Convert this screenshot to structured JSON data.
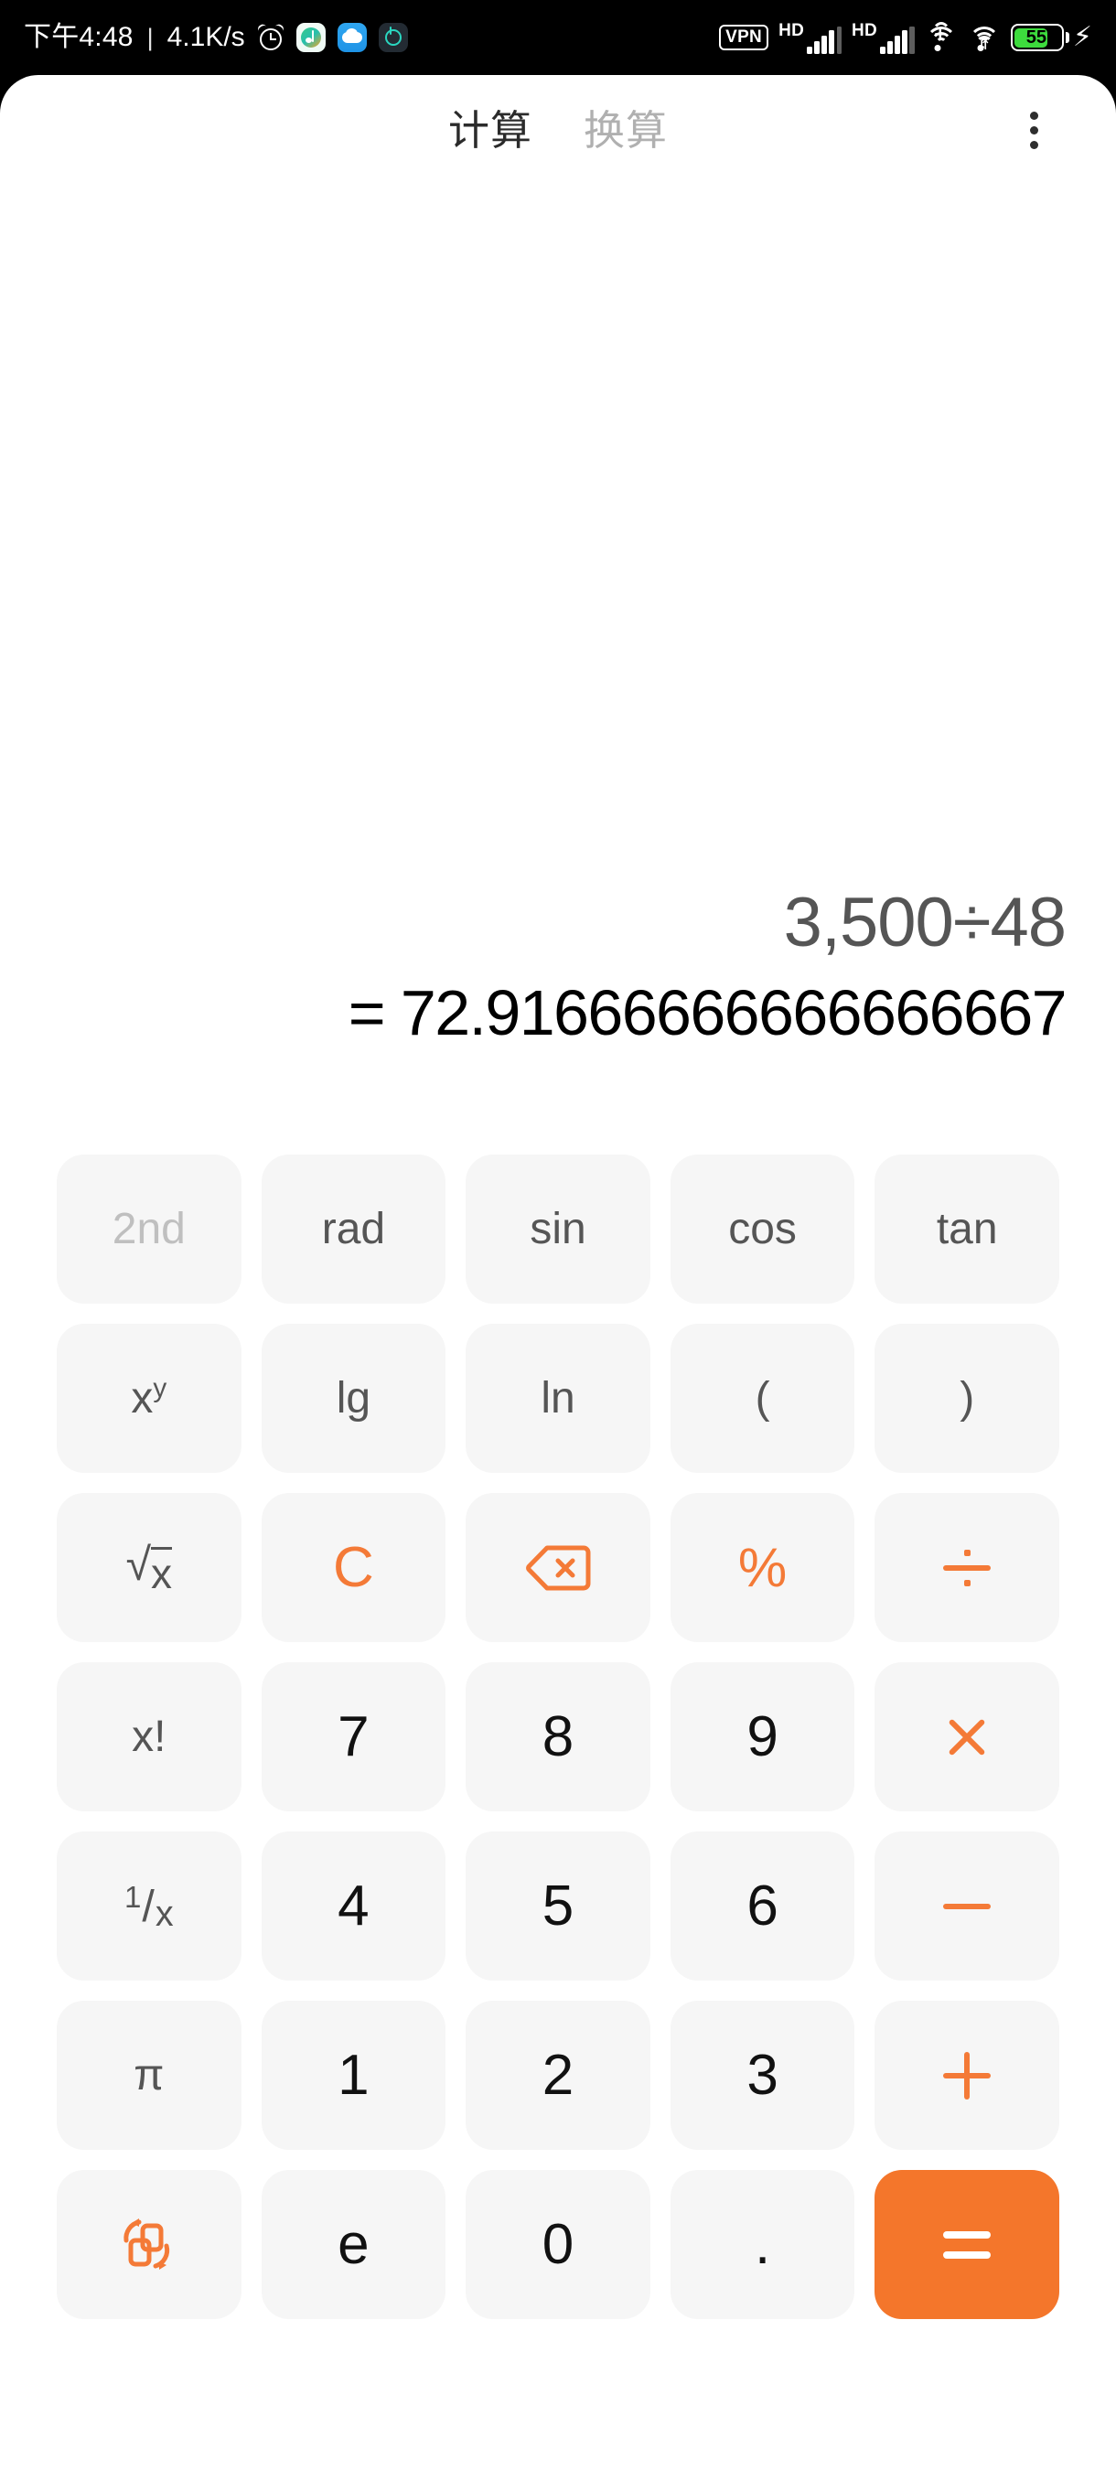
{
  "status_bar": {
    "clock": "下午4:48",
    "separator": "|",
    "network_speed": "4.1K/s",
    "left_icons": [
      "alarm-icon",
      "music-app-icon",
      "cloud-app-icon",
      "ring-app-icon"
    ],
    "vpn_label": "VPN",
    "sim1": {
      "hd_label": "HD",
      "bars": 4
    },
    "sim2": {
      "hd_label": "HD",
      "bars": 4
    },
    "wifi_primary": "wifi-plus-icon",
    "wifi_secondary": "wifi-icon",
    "battery_percent": "55",
    "battery_charging": true,
    "charging_glyph": "⚡",
    "colors": {
      "battery_fill": "#3ddc3d",
      "background": "#000000",
      "foreground": "#ffffff"
    }
  },
  "header": {
    "tabs": [
      {
        "label": "计算",
        "active": true
      },
      {
        "label": "换算",
        "active": false
      }
    ],
    "menu_icon": "more-vertical-icon"
  },
  "display": {
    "expression": "3,500÷48",
    "result": "= 72.91666666666666667"
  },
  "keypad": {
    "rows": [
      [
        {
          "label": "2nd",
          "kind": "fn-dim",
          "name": "key-2nd"
        },
        {
          "label": "rad",
          "kind": "fn",
          "name": "key-rad"
        },
        {
          "label": "sin",
          "kind": "fn",
          "name": "key-sin"
        },
        {
          "label": "cos",
          "kind": "fn",
          "name": "key-cos"
        },
        {
          "label": "tan",
          "kind": "fn",
          "name": "key-tan"
        }
      ],
      [
        {
          "label": "x^y",
          "kind": "fn",
          "name": "key-power"
        },
        {
          "label": "lg",
          "kind": "fn",
          "name": "key-log10"
        },
        {
          "label": "ln",
          "kind": "fn",
          "name": "key-ln"
        },
        {
          "label": "(",
          "kind": "fn",
          "name": "key-paren-open"
        },
        {
          "label": ")",
          "kind": "fn",
          "name": "key-paren-close"
        }
      ],
      [
        {
          "label": "√x",
          "kind": "fn",
          "name": "key-sqrt"
        },
        {
          "label": "C",
          "kind": "op",
          "name": "key-clear"
        },
        {
          "label": "backspace",
          "kind": "op",
          "name": "key-backspace"
        },
        {
          "label": "%",
          "kind": "op",
          "name": "key-percent"
        },
        {
          "label": "÷",
          "kind": "op",
          "name": "key-divide"
        }
      ],
      [
        {
          "label": "x!",
          "kind": "fn",
          "name": "key-factorial"
        },
        {
          "label": "7",
          "kind": "num",
          "name": "key-7"
        },
        {
          "label": "8",
          "kind": "num",
          "name": "key-8"
        },
        {
          "label": "9",
          "kind": "num",
          "name": "key-9"
        },
        {
          "label": "×",
          "kind": "op",
          "name": "key-multiply"
        }
      ],
      [
        {
          "label": "1/x",
          "kind": "fn",
          "name": "key-reciprocal"
        },
        {
          "label": "4",
          "kind": "num",
          "name": "key-4"
        },
        {
          "label": "5",
          "kind": "num",
          "name": "key-5"
        },
        {
          "label": "6",
          "kind": "num",
          "name": "key-6"
        },
        {
          "label": "−",
          "kind": "op",
          "name": "key-minus"
        }
      ],
      [
        {
          "label": "π",
          "kind": "fn",
          "name": "key-pi"
        },
        {
          "label": "1",
          "kind": "num",
          "name": "key-1"
        },
        {
          "label": "2",
          "kind": "num",
          "name": "key-2"
        },
        {
          "label": "3",
          "kind": "num",
          "name": "key-3"
        },
        {
          "label": "+",
          "kind": "op",
          "name": "key-plus"
        }
      ],
      [
        {
          "label": "convert",
          "kind": "op",
          "name": "key-convert"
        },
        {
          "label": "e",
          "kind": "num",
          "name": "key-e"
        },
        {
          "label": "0",
          "kind": "num",
          "name": "key-0"
        },
        {
          "label": ".",
          "kind": "num",
          "name": "key-decimal"
        },
        {
          "label": "=",
          "kind": "equals",
          "name": "key-equals"
        }
      ]
    ]
  },
  "theme": {
    "accent": "#f4762b",
    "accent_light": "#f47a37",
    "key_bg": "#f6f6f6",
    "app_bg": "#ffffff",
    "text_primary": "#1c1c1c",
    "text_secondary": "#555555",
    "text_disabled": "#bfbfbf"
  }
}
